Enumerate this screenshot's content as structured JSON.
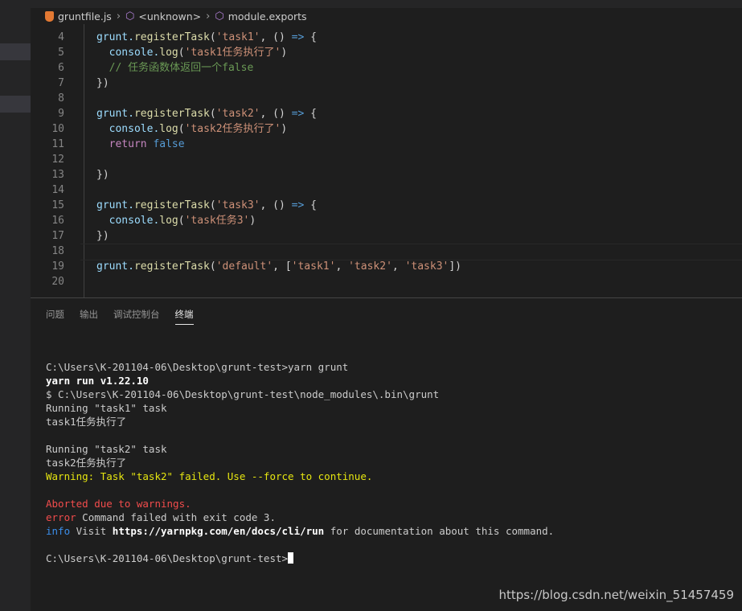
{
  "breadcrumb": {
    "file": "gruntfile.js",
    "scope": "<unknown>",
    "symbol": "module.exports"
  },
  "editor": {
    "lines": [
      {
        "num": "4",
        "tokens": [
          {
            "t": "grunt.",
            "c": "var"
          },
          {
            "t": "registerTask",
            "c": "fn"
          },
          {
            "t": "(",
            "c": ""
          },
          {
            "t": "'task1'",
            "c": "str"
          },
          {
            "t": ", () ",
            "c": ""
          },
          {
            "t": "=>",
            "c": "arrow"
          },
          {
            "t": " {",
            "c": ""
          }
        ]
      },
      {
        "num": "5",
        "tokens": [
          {
            "t": "  console.",
            "c": "var"
          },
          {
            "t": "log",
            "c": "fn"
          },
          {
            "t": "(",
            "c": ""
          },
          {
            "t": "'task1任务执行了'",
            "c": "str"
          },
          {
            "t": ")",
            "c": ""
          }
        ]
      },
      {
        "num": "6",
        "tokens": [
          {
            "t": "  // 任务函数体返回一个false",
            "c": "cm"
          }
        ]
      },
      {
        "num": "7",
        "tokens": [
          {
            "t": "})",
            "c": ""
          }
        ]
      },
      {
        "num": "8",
        "tokens": []
      },
      {
        "num": "9",
        "tokens": [
          {
            "t": "grunt.",
            "c": "var"
          },
          {
            "t": "registerTask",
            "c": "fn"
          },
          {
            "t": "(",
            "c": ""
          },
          {
            "t": "'task2'",
            "c": "str"
          },
          {
            "t": ", () ",
            "c": ""
          },
          {
            "t": "=>",
            "c": "arrow"
          },
          {
            "t": " {",
            "c": ""
          }
        ]
      },
      {
        "num": "10",
        "tokens": [
          {
            "t": "  console.",
            "c": "var"
          },
          {
            "t": "log",
            "c": "fn"
          },
          {
            "t": "(",
            "c": ""
          },
          {
            "t": "'task2任务执行了'",
            "c": "str"
          },
          {
            "t": ")",
            "c": ""
          }
        ]
      },
      {
        "num": "11",
        "tokens": [
          {
            "t": "  return",
            "c": "kw"
          },
          {
            "t": " ",
            "c": ""
          },
          {
            "t": "false",
            "c": "bool"
          }
        ]
      },
      {
        "num": "12",
        "tokens": []
      },
      {
        "num": "13",
        "tokens": [
          {
            "t": "})",
            "c": ""
          }
        ]
      },
      {
        "num": "14",
        "tokens": []
      },
      {
        "num": "15",
        "tokens": [
          {
            "t": "grunt.",
            "c": "var"
          },
          {
            "t": "registerTask",
            "c": "fn"
          },
          {
            "t": "(",
            "c": ""
          },
          {
            "t": "'task3'",
            "c": "str"
          },
          {
            "t": ", () ",
            "c": ""
          },
          {
            "t": "=>",
            "c": "arrow"
          },
          {
            "t": " {",
            "c": ""
          }
        ]
      },
      {
        "num": "16",
        "tokens": [
          {
            "t": "  console.",
            "c": "var"
          },
          {
            "t": "log",
            "c": "fn"
          },
          {
            "t": "(",
            "c": ""
          },
          {
            "t": "'task任务3'",
            "c": "str"
          },
          {
            "t": ")",
            "c": ""
          }
        ]
      },
      {
        "num": "17",
        "tokens": [
          {
            "t": "})",
            "c": ""
          }
        ]
      },
      {
        "num": "18",
        "tokens": []
      },
      {
        "num": "19",
        "tokens": [
          {
            "t": "grunt.",
            "c": "var"
          },
          {
            "t": "registerTask",
            "c": "fn"
          },
          {
            "t": "(",
            "c": ""
          },
          {
            "t": "'default'",
            "c": "str"
          },
          {
            "t": ", [",
            "c": ""
          },
          {
            "t": "'task1'",
            "c": "str"
          },
          {
            "t": ", ",
            "c": ""
          },
          {
            "t": "'task2'",
            "c": "str"
          },
          {
            "t": ", ",
            "c": ""
          },
          {
            "t": "'task3'",
            "c": "str"
          },
          {
            "t": "])",
            "c": ""
          }
        ]
      },
      {
        "num": "20",
        "tokens": []
      }
    ]
  },
  "panel": {
    "tabs": [
      "问题",
      "输出",
      "调试控制台",
      "终端"
    ],
    "active_tab": "终端",
    "terminal": [
      {
        "text": "",
        "style": ""
      },
      {
        "text": "C:\\Users\\K-201104-06\\Desktop\\grunt-test>yarn grunt",
        "style": ""
      },
      {
        "text": "yarn run v1.22.10",
        "style": "bold"
      },
      {
        "text": "$ C:\\Users\\K-201104-06\\Desktop\\grunt-test\\node_modules\\.bin\\grunt",
        "style": ""
      },
      {
        "text": "Running \"task1\" task",
        "style": ""
      },
      {
        "text": "task1任务执行了",
        "style": ""
      },
      {
        "text": "",
        "style": ""
      },
      {
        "text": "Running \"task2\" task",
        "style": ""
      },
      {
        "text": "task2任务执行了",
        "style": ""
      },
      {
        "text": "Warning: Task \"task2\" failed. Use --force to continue.",
        "style": "yellow"
      },
      {
        "text": "",
        "style": ""
      },
      {
        "text": "Aborted due to warnings.",
        "style": "red"
      },
      {
        "parts": [
          {
            "t": "error",
            "c": "red"
          },
          {
            "t": " Command failed with exit code 3.",
            "c": ""
          }
        ]
      },
      {
        "parts": [
          {
            "t": "info",
            "c": "blue"
          },
          {
            "t": " Visit ",
            "c": ""
          },
          {
            "t": "https://yarnpkg.com/en/docs/cli/run",
            "c": "bold"
          },
          {
            "t": " for documentation about this command.",
            "c": ""
          }
        ]
      },
      {
        "text": "",
        "style": ""
      },
      {
        "text": "C:\\Users\\K-201104-06\\Desktop\\grunt-test>",
        "style": "",
        "cursor": true
      }
    ]
  },
  "watermark": "https://blog.csdn.net/weixin_51457459"
}
